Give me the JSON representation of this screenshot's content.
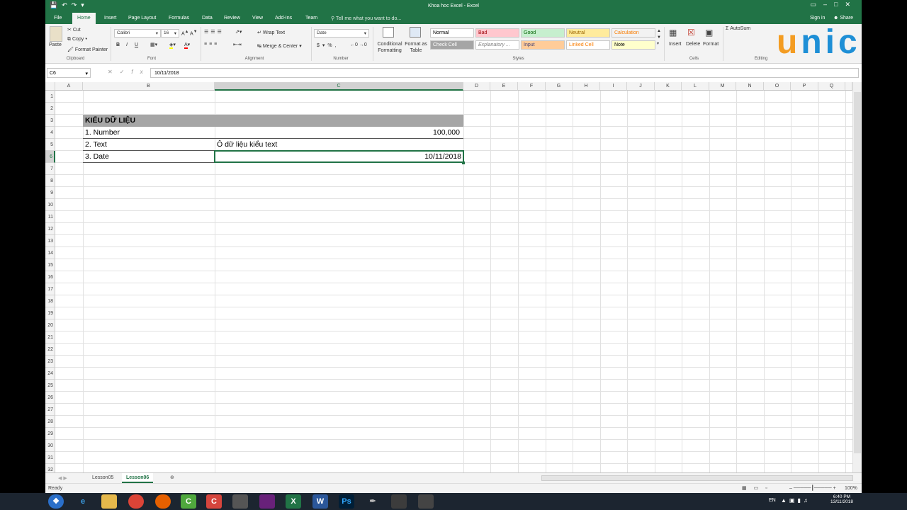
{
  "window": {
    "title": "Khoa hoc Excel - Excel"
  },
  "tabs": [
    "File",
    "Home",
    "Insert",
    "Page Layout",
    "Formulas",
    "Data",
    "Review",
    "View",
    "Add-Ins",
    "Team"
  ],
  "active_tab": "Home",
  "tell_me": "Tell me what you want to do...",
  "sign_in": "Sign in",
  "share": "Share",
  "ribbon": {
    "clipboard": {
      "paste": "Paste",
      "cut": "Cut",
      "copy": "Copy",
      "format_painter": "Format Painter",
      "label": "Clipboard"
    },
    "font": {
      "name": "Calibri",
      "size": "16",
      "bold": "B",
      "italic": "I",
      "underline": "U",
      "label": "Font"
    },
    "alignment": {
      "wrap": "Wrap Text",
      "merge": "Merge & Center",
      "label": "Alignment"
    },
    "number": {
      "format": "Date",
      "label": "Number"
    },
    "styles": {
      "conditional": "Conditional Formatting",
      "format_table": "Format as Table",
      "label": "Styles",
      "cells": [
        {
          "text": "Normal",
          "bg": "#ffffff",
          "fg": "#000000"
        },
        {
          "text": "Bad",
          "bg": "#ffc7ce",
          "fg": "#9c0006"
        },
        {
          "text": "Good",
          "bg": "#c6efce",
          "fg": "#006100"
        },
        {
          "text": "Neutral",
          "bg": "#ffeb9c",
          "fg": "#9c6500"
        },
        {
          "text": "Calculation",
          "bg": "#f2f2f2",
          "fg": "#fa7d00"
        },
        {
          "text": "Check Cell",
          "bg": "#a5a5a5",
          "fg": "#ffffff"
        },
        {
          "text": "Explanatory ...",
          "bg": "#ffffff",
          "fg": "#7f7f7f"
        },
        {
          "text": "Input",
          "bg": "#ffcc99",
          "fg": "#3f3f76"
        },
        {
          "text": "Linked Cell",
          "bg": "#ffffff",
          "fg": "#fa7d00"
        },
        {
          "text": "Note",
          "bg": "#ffffcc",
          "fg": "#000000"
        }
      ]
    },
    "cells": {
      "insert": "Insert",
      "delete": "Delete",
      "format": "Format",
      "label": "Cells"
    },
    "editing": {
      "autosum": "AutoSum",
      "label": "Editing"
    }
  },
  "formula_bar": {
    "name_box": "C6",
    "value": "10/11/2018"
  },
  "columns": [
    "A",
    "B",
    "C",
    "D",
    "E",
    "F",
    "G",
    "H",
    "I",
    "J",
    "K",
    "L",
    "M",
    "N",
    "O",
    "P",
    "Q"
  ],
  "rows": [
    "1",
    "2",
    "3",
    "4",
    "5",
    "6",
    "7",
    "8",
    "9",
    "10",
    "11",
    "12",
    "13",
    "14",
    "15",
    "16",
    "17",
    "18",
    "19",
    "20",
    "21",
    "22",
    "23",
    "24",
    "25",
    "26",
    "27",
    "28",
    "29",
    "30",
    "31",
    "32"
  ],
  "cells": {
    "B3": "KIỂU DỮ LIỆU",
    "B4": "1. Number",
    "C4": "100,000",
    "B5": "2. Text",
    "C5": "Ô dữ liệu kiểu text",
    "B6": "3. Date",
    "C6": "10/11/2018"
  },
  "sheets": [
    "Lesson05",
    "Lesson06"
  ],
  "active_sheet": "Lesson06",
  "status": {
    "ready": "Ready",
    "zoom": "100%"
  },
  "taskbar": {
    "lang": "EN",
    "time": "6:40 PM",
    "date": "13/11/2018"
  },
  "logo": {
    "text": "unica"
  },
  "colors": {
    "excel_green": "#217346",
    "header_fill": "#a6a6a6"
  }
}
